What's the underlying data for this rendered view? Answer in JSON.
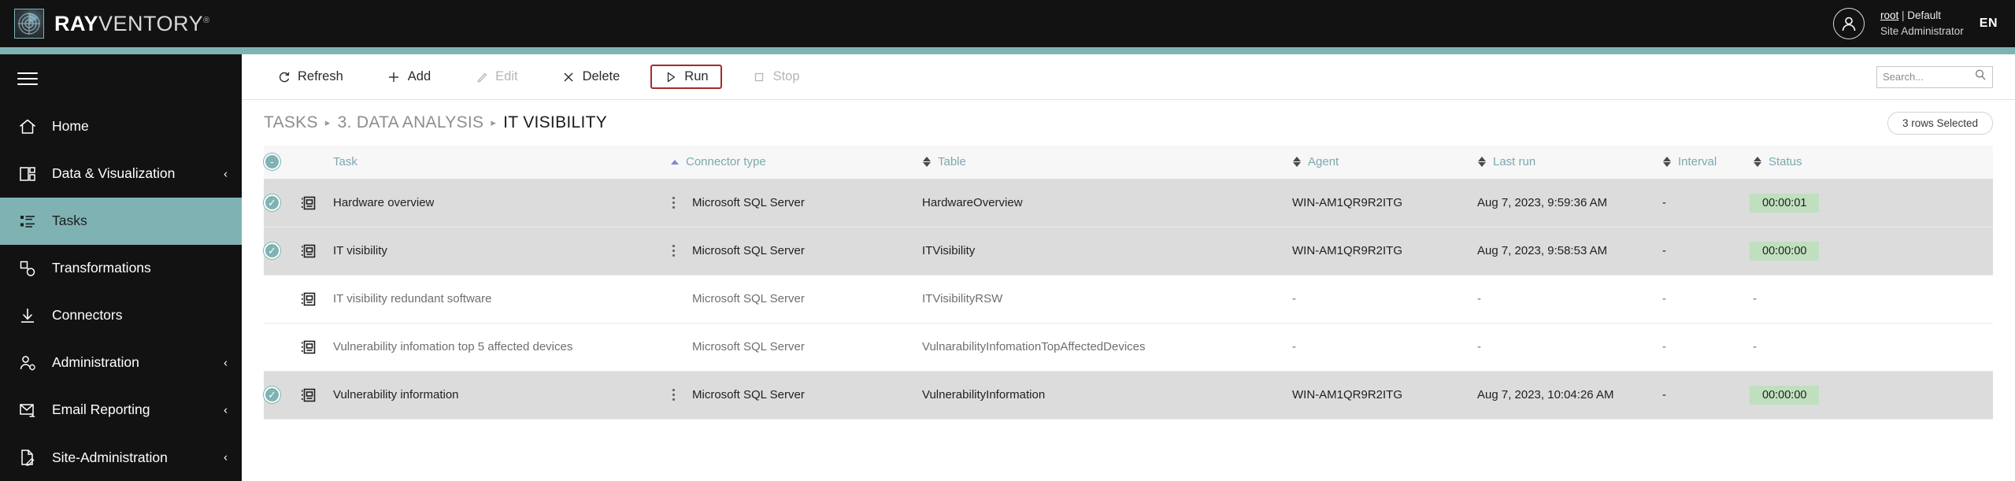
{
  "header": {
    "brand": {
      "part1": "RAY",
      "part2": "VENTORY",
      "mark": "®",
      "logo_icon": "radar-icon"
    },
    "user": {
      "name": "root",
      "separator": "|",
      "tenant": "Default",
      "role": "Site Administrator"
    },
    "language": "EN"
  },
  "sidebar": {
    "menu_icon": "hamburger-icon",
    "items": [
      {
        "label": "Home",
        "icon": "home-icon",
        "active": false,
        "expandable": false
      },
      {
        "label": "Data & Visualization",
        "icon": "dashboard-icon",
        "active": false,
        "expandable": true
      },
      {
        "label": "Tasks",
        "icon": "task-list-icon",
        "active": true,
        "expandable": false
      },
      {
        "label": "Transformations",
        "icon": "transformations-icon",
        "active": false,
        "expandable": false
      },
      {
        "label": "Connectors",
        "icon": "download-icon",
        "active": false,
        "expandable": false
      },
      {
        "label": "Administration",
        "icon": "user-gear-icon",
        "active": false,
        "expandable": true
      },
      {
        "label": "Email Reporting",
        "icon": "mail-forward-icon",
        "active": false,
        "expandable": true
      },
      {
        "label": "Site-Administration",
        "icon": "document-pen-icon",
        "active": false,
        "expandable": true
      }
    ],
    "chevron": "‹"
  },
  "toolbar": {
    "buttons": [
      {
        "label": "Refresh",
        "icon": "refresh-icon",
        "state": "enabled"
      },
      {
        "label": "Add",
        "icon": "plus-icon",
        "state": "enabled"
      },
      {
        "label": "Edit",
        "icon": "pencil-icon",
        "state": "disabled"
      },
      {
        "label": "Delete",
        "icon": "close-x-icon",
        "state": "enabled"
      },
      {
        "label": "Run",
        "icon": "play-icon",
        "state": "highlighted"
      },
      {
        "label": "Stop",
        "icon": "square-icon",
        "state": "disabled"
      }
    ],
    "search": {
      "placeholder": "Search...",
      "value": "",
      "icon": "search-icon"
    }
  },
  "breadcrumb": {
    "items": [
      "TASKS",
      "3. DATA ANALYSIS",
      "IT VISIBILITY"
    ],
    "separator": "▸",
    "current_index": 2
  },
  "selection_badge": "3 rows Selected",
  "table": {
    "select_all_state": "indeterminate",
    "select_all_glyph": "-",
    "columns": [
      {
        "label": "Task",
        "sort": "none"
      },
      {
        "label": "Connector type",
        "sort": "asc"
      },
      {
        "label": "Table",
        "sort": "none"
      },
      {
        "label": "Agent",
        "sort": "none"
      },
      {
        "label": "Last run",
        "sort": "none"
      },
      {
        "label": "Interval",
        "sort": "none"
      },
      {
        "label": "Status",
        "sort": "none"
      }
    ],
    "rows": [
      {
        "selected": true,
        "icon": "task-icon",
        "task": "Hardware overview",
        "connector_type": "Microsoft SQL Server",
        "table": "HardwareOverview",
        "agent": "WIN-AM1QR9R2ITG",
        "last_run": "Aug 7, 2023, 9:59:36 AM",
        "interval": "-",
        "status": "00:00:01",
        "status_badge": true
      },
      {
        "selected": true,
        "icon": "task-icon",
        "task": "IT visibility",
        "connector_type": "Microsoft SQL Server",
        "table": "ITVisibility",
        "agent": "WIN-AM1QR9R2ITG",
        "last_run": "Aug 7, 2023, 9:58:53 AM",
        "interval": "-",
        "status": "00:00:00",
        "status_badge": true
      },
      {
        "selected": false,
        "icon": "task-icon",
        "task": "IT visibility redundant software",
        "connector_type": "Microsoft SQL Server",
        "table": "ITVisibilityRSW",
        "agent": "-",
        "last_run": "-",
        "interval": "-",
        "status": "-",
        "status_badge": false
      },
      {
        "selected": false,
        "icon": "task-icon",
        "task": "Vulnerability infomation top 5 affected devices",
        "connector_type": "Microsoft SQL Server",
        "table": "VulnarabilityInfomationTopAffectedDevices",
        "agent": "-",
        "last_run": "-",
        "interval": "-",
        "status": "-",
        "status_badge": false
      },
      {
        "selected": true,
        "icon": "task-icon",
        "task": "Vulnerability information",
        "connector_type": "Microsoft SQL Server",
        "table": "VulnerabilityInformation",
        "agent": "WIN-AM1QR9R2ITG",
        "last_run": "Aug 7, 2023, 10:04:26 AM",
        "interval": "-",
        "status": "00:00:00",
        "status_badge": true
      }
    ]
  },
  "colors": {
    "accent_teal": "#7fb3b3",
    "header_black": "#121212",
    "run_highlight": "#a52a2a",
    "status_green": "#bfdfbf",
    "selected_row": "#dcdcdc",
    "header_text_teal": "#7aa9b0"
  }
}
